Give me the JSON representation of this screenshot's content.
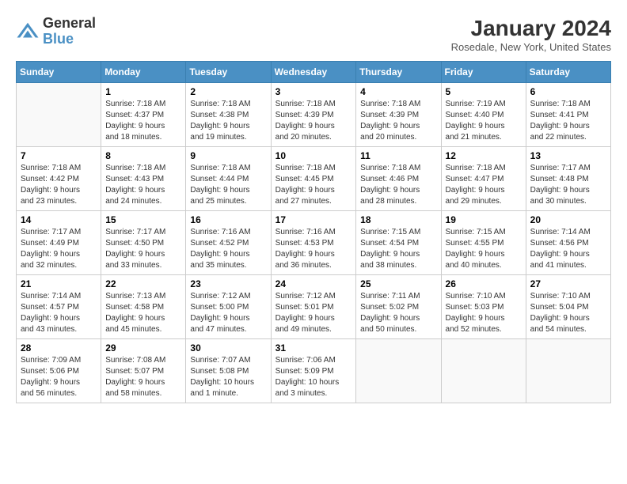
{
  "header": {
    "title": "January 2024",
    "subtitle": "Rosedale, New York, United States",
    "logo_line1": "General",
    "logo_line2": "Blue"
  },
  "weekdays": [
    "Sunday",
    "Monday",
    "Tuesday",
    "Wednesday",
    "Thursday",
    "Friday",
    "Saturday"
  ],
  "weeks": [
    [
      {
        "day": "",
        "info": ""
      },
      {
        "day": "1",
        "info": "Sunrise: 7:18 AM\nSunset: 4:37 PM\nDaylight: 9 hours\nand 18 minutes."
      },
      {
        "day": "2",
        "info": "Sunrise: 7:18 AM\nSunset: 4:38 PM\nDaylight: 9 hours\nand 19 minutes."
      },
      {
        "day": "3",
        "info": "Sunrise: 7:18 AM\nSunset: 4:39 PM\nDaylight: 9 hours\nand 20 minutes."
      },
      {
        "day": "4",
        "info": "Sunrise: 7:18 AM\nSunset: 4:39 PM\nDaylight: 9 hours\nand 20 minutes."
      },
      {
        "day": "5",
        "info": "Sunrise: 7:19 AM\nSunset: 4:40 PM\nDaylight: 9 hours\nand 21 minutes."
      },
      {
        "day": "6",
        "info": "Sunrise: 7:18 AM\nSunset: 4:41 PM\nDaylight: 9 hours\nand 22 minutes."
      }
    ],
    [
      {
        "day": "7",
        "info": "Sunrise: 7:18 AM\nSunset: 4:42 PM\nDaylight: 9 hours\nand 23 minutes."
      },
      {
        "day": "8",
        "info": "Sunrise: 7:18 AM\nSunset: 4:43 PM\nDaylight: 9 hours\nand 24 minutes."
      },
      {
        "day": "9",
        "info": "Sunrise: 7:18 AM\nSunset: 4:44 PM\nDaylight: 9 hours\nand 25 minutes."
      },
      {
        "day": "10",
        "info": "Sunrise: 7:18 AM\nSunset: 4:45 PM\nDaylight: 9 hours\nand 27 minutes."
      },
      {
        "day": "11",
        "info": "Sunrise: 7:18 AM\nSunset: 4:46 PM\nDaylight: 9 hours\nand 28 minutes."
      },
      {
        "day": "12",
        "info": "Sunrise: 7:18 AM\nSunset: 4:47 PM\nDaylight: 9 hours\nand 29 minutes."
      },
      {
        "day": "13",
        "info": "Sunrise: 7:17 AM\nSunset: 4:48 PM\nDaylight: 9 hours\nand 30 minutes."
      }
    ],
    [
      {
        "day": "14",
        "info": "Sunrise: 7:17 AM\nSunset: 4:49 PM\nDaylight: 9 hours\nand 32 minutes."
      },
      {
        "day": "15",
        "info": "Sunrise: 7:17 AM\nSunset: 4:50 PM\nDaylight: 9 hours\nand 33 minutes."
      },
      {
        "day": "16",
        "info": "Sunrise: 7:16 AM\nSunset: 4:52 PM\nDaylight: 9 hours\nand 35 minutes."
      },
      {
        "day": "17",
        "info": "Sunrise: 7:16 AM\nSunset: 4:53 PM\nDaylight: 9 hours\nand 36 minutes."
      },
      {
        "day": "18",
        "info": "Sunrise: 7:15 AM\nSunset: 4:54 PM\nDaylight: 9 hours\nand 38 minutes."
      },
      {
        "day": "19",
        "info": "Sunrise: 7:15 AM\nSunset: 4:55 PM\nDaylight: 9 hours\nand 40 minutes."
      },
      {
        "day": "20",
        "info": "Sunrise: 7:14 AM\nSunset: 4:56 PM\nDaylight: 9 hours\nand 41 minutes."
      }
    ],
    [
      {
        "day": "21",
        "info": "Sunrise: 7:14 AM\nSunset: 4:57 PM\nDaylight: 9 hours\nand 43 minutes."
      },
      {
        "day": "22",
        "info": "Sunrise: 7:13 AM\nSunset: 4:58 PM\nDaylight: 9 hours\nand 45 minutes."
      },
      {
        "day": "23",
        "info": "Sunrise: 7:12 AM\nSunset: 5:00 PM\nDaylight: 9 hours\nand 47 minutes."
      },
      {
        "day": "24",
        "info": "Sunrise: 7:12 AM\nSunset: 5:01 PM\nDaylight: 9 hours\nand 49 minutes."
      },
      {
        "day": "25",
        "info": "Sunrise: 7:11 AM\nSunset: 5:02 PM\nDaylight: 9 hours\nand 50 minutes."
      },
      {
        "day": "26",
        "info": "Sunrise: 7:10 AM\nSunset: 5:03 PM\nDaylight: 9 hours\nand 52 minutes."
      },
      {
        "day": "27",
        "info": "Sunrise: 7:10 AM\nSunset: 5:04 PM\nDaylight: 9 hours\nand 54 minutes."
      }
    ],
    [
      {
        "day": "28",
        "info": "Sunrise: 7:09 AM\nSunset: 5:06 PM\nDaylight: 9 hours\nand 56 minutes."
      },
      {
        "day": "29",
        "info": "Sunrise: 7:08 AM\nSunset: 5:07 PM\nDaylight: 9 hours\nand 58 minutes."
      },
      {
        "day": "30",
        "info": "Sunrise: 7:07 AM\nSunset: 5:08 PM\nDaylight: 10 hours\nand 1 minute."
      },
      {
        "day": "31",
        "info": "Sunrise: 7:06 AM\nSunset: 5:09 PM\nDaylight: 10 hours\nand 3 minutes."
      },
      {
        "day": "",
        "info": ""
      },
      {
        "day": "",
        "info": ""
      },
      {
        "day": "",
        "info": ""
      }
    ]
  ]
}
